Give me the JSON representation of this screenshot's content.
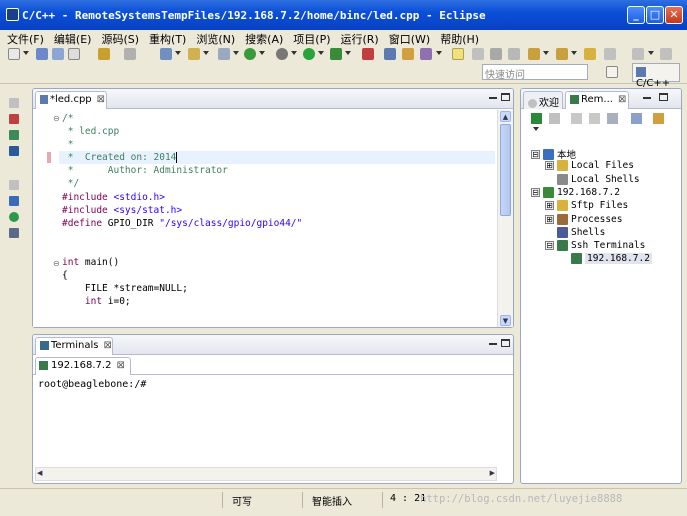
{
  "window": {
    "title": "C/C++ - RemoteSystemsTempFiles/192.168.7.2/home/binc/led.cpp - Eclipse",
    "minimize": "_",
    "maximize": "□",
    "close": "✕"
  },
  "menu": [
    "文件(F)",
    "编辑(E)",
    "源码(S)",
    "重构(T)",
    "浏览(N)",
    "搜索(A)",
    "项目(P)",
    "运行(R)",
    "窗口(W)",
    "帮助(H)"
  ],
  "toolbar": {
    "quick_access_placeholder": "快速访问",
    "perspective_label": "C/C++"
  },
  "editor": {
    "tab_label": "*led.cpp",
    "tab_close": "⊠",
    "lines": [
      {
        "text": "/*",
        "cls": "c-comment"
      },
      {
        "text": " * led.cpp",
        "cls": "c-comment"
      },
      {
        "text": " *",
        "cls": "c-comment"
      },
      {
        "text": " *  Created on: 2014",
        "cls": "c-comment",
        "hl": true
      },
      {
        "text": " *      Author: Administrator",
        "cls": "c-comment"
      },
      {
        "text": " */",
        "cls": "c-comment"
      },
      {
        "pp": "#include",
        "rest": " <stdio.h>",
        "restcls": "c-inc"
      },
      {
        "pp": "#include",
        "rest": " <sys/stat.h>",
        "restcls": "c-inc"
      },
      {
        "pp": "#define",
        "rest": " GPIO_DIR ",
        "str": "\"/sys/class/gpio/gpio44/\""
      },
      {
        "text": ""
      },
      {
        "text": ""
      },
      {
        "kw": "int",
        "rest": " main()"
      },
      {
        "text": "{"
      },
      {
        "text": "    FILE *stream=NULL;"
      },
      {
        "kw": "    int",
        "rest": " i=0;"
      }
    ]
  },
  "terminals": {
    "view_label": "Terminals",
    "view_close": "⊠",
    "tab_label": "192.168.7.2",
    "tab_close": "⊠",
    "prompt": "root@beaglebone:/#"
  },
  "remote": {
    "tab_welcome": "欢迎",
    "tab_remote": "Rem...",
    "tab_close": "⊠",
    "tree": [
      {
        "label": "本地",
        "level": 0,
        "exp": "⊟",
        "icon": "#3b6fc2"
      },
      {
        "label": "Local Files",
        "level": 1,
        "exp": "⊞",
        "icon": "#d9b13d"
      },
      {
        "label": "Local Shells",
        "level": 1,
        "exp": "",
        "icon": "#8a8a8a"
      },
      {
        "label": "192.168.7.2",
        "level": 0,
        "exp": "⊟",
        "icon": "#3a8a3a"
      },
      {
        "label": "Sftp Files",
        "level": 1,
        "exp": "⊞",
        "icon": "#d9b13d"
      },
      {
        "label": "Processes",
        "level": 1,
        "exp": "⊞",
        "icon": "#9a6a3a"
      },
      {
        "label": "Shells",
        "level": 1,
        "exp": "",
        "icon": "#4a5a9a"
      },
      {
        "label": "Ssh Terminals",
        "level": 1,
        "exp": "⊟",
        "icon": "#3a7a4a"
      },
      {
        "label": "192.168.7.2",
        "level": 2,
        "exp": "",
        "icon": "#3a7a4a",
        "selected": true
      }
    ]
  },
  "status": {
    "writable": "可写",
    "insert_mode": "智能插入",
    "position": "4 : 21",
    "watermark": "http://blog.csdn.net/luyejie8888"
  }
}
